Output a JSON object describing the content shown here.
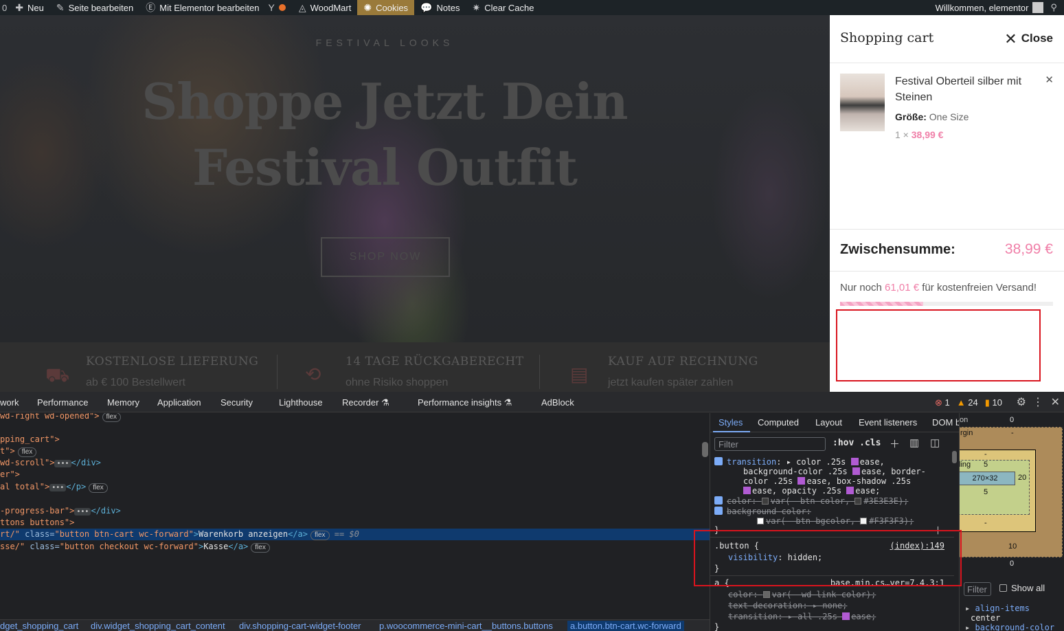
{
  "admin_bar": {
    "items": [
      "Neu",
      "Seite bearbeiten",
      "Mit Elementor bearbeiten",
      "WoodMart",
      "Cookies",
      "Notes",
      "Clear Cache"
    ],
    "greeting": "Willkommen, elementor"
  },
  "hero": {
    "kicker": "FESTIVAL LOOKS",
    "title_line1": "Shoppe Jetzt Dein",
    "title_line2": "Festival Outfit",
    "button": "SHOP NOW"
  },
  "features": [
    {
      "title": "KOSTENLOSE LIEFERUNG",
      "subtitle": "ab € 100 Bestellwert"
    },
    {
      "title": "14 TAGE RÜCKGABERECHT",
      "subtitle": "ohne Risiko shoppen"
    },
    {
      "title": "KAUF AUF RECHNUNG",
      "subtitle": "jetzt kaufen später zahlen"
    }
  ],
  "cart": {
    "title": "Shopping cart",
    "close_label": "Close",
    "item": {
      "name": "Festival Oberteil silber mit Steinen",
      "attr_label": "Größe:",
      "attr_value": "One Size",
      "qty": "1 ×",
      "price": "38,99 €"
    },
    "subtotal_label": "Zwischensumme:",
    "subtotal_value": "38,99 €",
    "shipping_prefix": "Nur noch",
    "shipping_amount": "61,01 €",
    "shipping_suffix": "für kostenfreien Versand!",
    "shipping_progress": 0.39
  },
  "devtools": {
    "tabs": [
      "work",
      "Performance",
      "Memory",
      "Application",
      "Security",
      "Lighthouse",
      "Recorder",
      "Performance insights",
      "AdBlock"
    ],
    "errors": "1",
    "warnings": "24",
    "issues": "10",
    "element_lines": [
      {
        "pre": " wd-right wd-opened\">",
        "badge": "flex"
      },
      {
        "pre": "pping_cart\">",
        "badge": ""
      },
      {
        "pre": "t\">",
        "badge": "flex"
      },
      {
        "pre": " wd-scroll\">",
        "badge": "",
        "ell": true,
        "post": "</div>"
      },
      {
        "pre": "er\">",
        "badge": ""
      },
      {
        "pre": "al total\">",
        "badge": "flex",
        "ell": true,
        "post": "</p>"
      },
      {
        "pre": "-progress-bar\">",
        "badge": "",
        "ell": true,
        "post": "</div>"
      },
      {
        "pre": "ttons buttons\">",
        "badge": ""
      }
    ],
    "selected_line": {
      "href_tail": "rt/\"",
      "class_val": "\"button btn-cart wc-forward\"",
      "text": "Warenkorb anzeigen",
      "badge": "flex",
      "marker": "== $0"
    },
    "checkout_line": {
      "href_tail": "sse/\"",
      "class_val": "\"button checkout wc-forward\"",
      "text": "Kasse",
      "badge": "flex"
    },
    "breadcrumbs": [
      "dget_shopping_cart",
      "div.widget_shopping_cart_content",
      "div.shopping-cart-widget-footer",
      "p.woocommerce-mini-cart__buttons.buttons",
      "a.button.btn-cart.wc-forward"
    ],
    "styles_tabs": [
      "Styles",
      "Computed",
      "Layout",
      "Event listeners",
      "DOM breakpoints"
    ],
    "filter_placeholder": "Filter",
    "hov": ":hov",
    "cls": ".cls",
    "rules": {
      "transition_prop": "transition",
      "transition_l1": "color .25s",
      "transition_e1": "ease,",
      "transition_l2": "background-color .25s",
      "transition_e2": "ease, border-",
      "transition_l3": "color .25s",
      "transition_e3": "ease, box-shadow .25s",
      "transition_e4": "ease, opacity .25s",
      "transition_e5": "ease;",
      "color_prop": "color",
      "color_val": "var(--btn-color,",
      "color_hex": "#3E3E3E);",
      "bg_prop": "background-color",
      "bg_val": "var(--btn-bgcolor,",
      "bg_hex": "#F3F3F3);",
      "button_selector": ".button {",
      "button_source": "(index):149",
      "visibility_prop": "visibility",
      "visibility_val": "hidden;",
      "a_selector": "a {",
      "a_source": "base.min.cs…ver=7.4.3:1",
      "a_color_prop": "color",
      "a_color_val": "var(--wd-link-color);",
      "a_td_prop": "text-decoration",
      "a_td_val": "none;",
      "a_tr_prop": "transition",
      "a_tr_val": "all .25s",
      "a_tr_ease": "ease;"
    },
    "box_model": {
      "position_val": "0",
      "margin_label": "rgin",
      "margin_val": "-",
      "border_label": "border",
      "border_val": "-",
      "padding_label": "padding",
      "padding_top": "5",
      "padding_left": "20",
      "padding_right": "20",
      "padding_bottom": "5",
      "content": "270×32",
      "bottom_dash": "-",
      "margin_bottom": "10",
      "bottom_val": "0"
    },
    "computed": {
      "filter": "Filter",
      "show_all": "Show all",
      "prop1": "align-items",
      "val1": "center",
      "prop2": "background-color"
    }
  }
}
